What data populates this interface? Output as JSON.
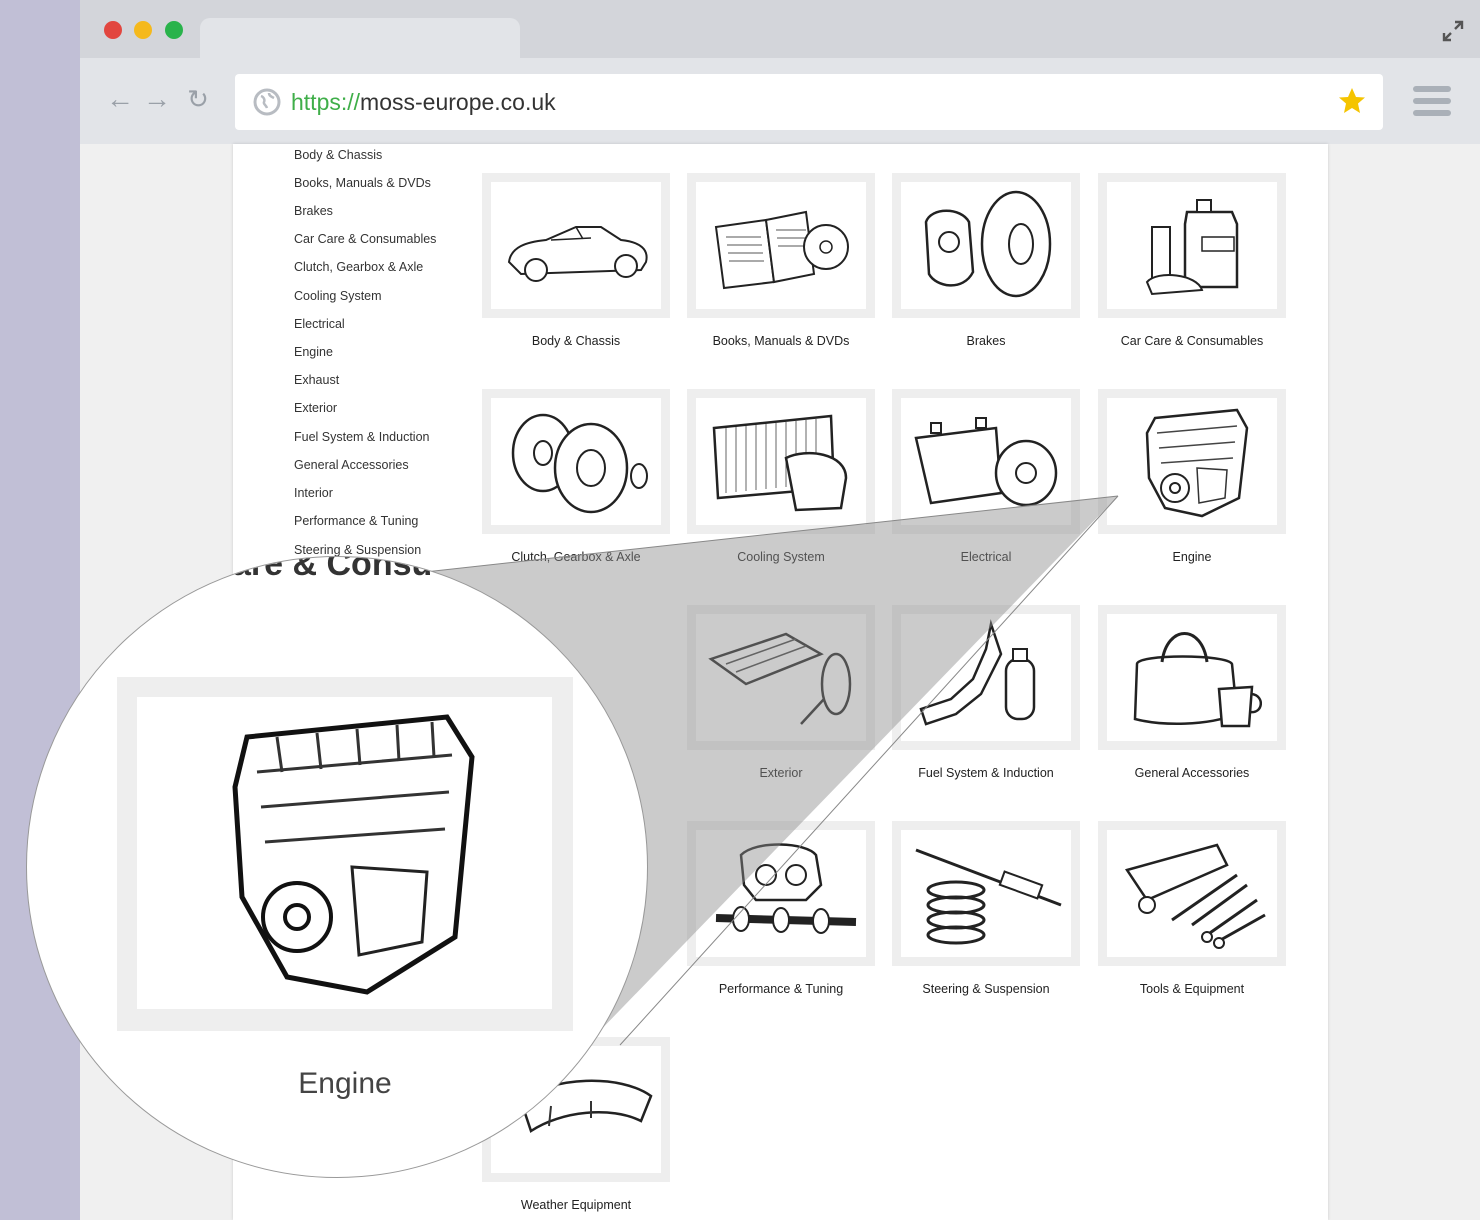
{
  "browser": {
    "url_scheme": "https://",
    "url_host": "moss-europe.co.uk",
    "traffic_lights": [
      "#e2463f",
      "#f5b91c",
      "#29b34b"
    ],
    "accent_star": "#f5c400"
  },
  "sidebar": {
    "items": [
      "Body & Chassis",
      "Books, Manuals & DVDs",
      "Brakes",
      "Car Care & Consumables",
      "Clutch, Gearbox & Axle",
      "Cooling System",
      "Electrical",
      "Engine",
      "Exhaust",
      "Exterior",
      "Fuel System & Induction",
      "General Accessories",
      "Interior",
      "Performance & Tuning",
      "Steering & Suspension"
    ]
  },
  "categories": [
    {
      "label": "Body & Chassis",
      "icon": "car-body-icon"
    },
    {
      "label": "Books, Manuals & DVDs",
      "icon": "books-icon"
    },
    {
      "label": "Brakes",
      "icon": "brake-disc-icon"
    },
    {
      "label": "Car Care & Consumables",
      "icon": "oil-can-icon"
    },
    {
      "label": "Clutch, Gearbox & Axle",
      "icon": "clutch-icon"
    },
    {
      "label": "Cooling System",
      "icon": "radiator-icon"
    },
    {
      "label": "Electrical",
      "icon": "battery-icon"
    },
    {
      "label": "Engine",
      "icon": "engine-icon"
    },
    {
      "label": "Exterior",
      "icon": "luggage-rack-icon"
    },
    {
      "label": "Fuel System & Induction",
      "icon": "fuel-pump-icon"
    },
    {
      "label": "General Accessories",
      "icon": "bag-icon"
    },
    {
      "label": "Performance & Tuning",
      "icon": "carburettor-icon"
    },
    {
      "label": "Steering & Suspension",
      "icon": "spring-icon"
    },
    {
      "label": "Tools & Equipment",
      "icon": "tools-icon"
    },
    {
      "label": "Weather Equipment",
      "icon": "soft-top-icon"
    }
  ],
  "magnifier": {
    "background_heading": "are & Consu",
    "label": "Engine"
  }
}
